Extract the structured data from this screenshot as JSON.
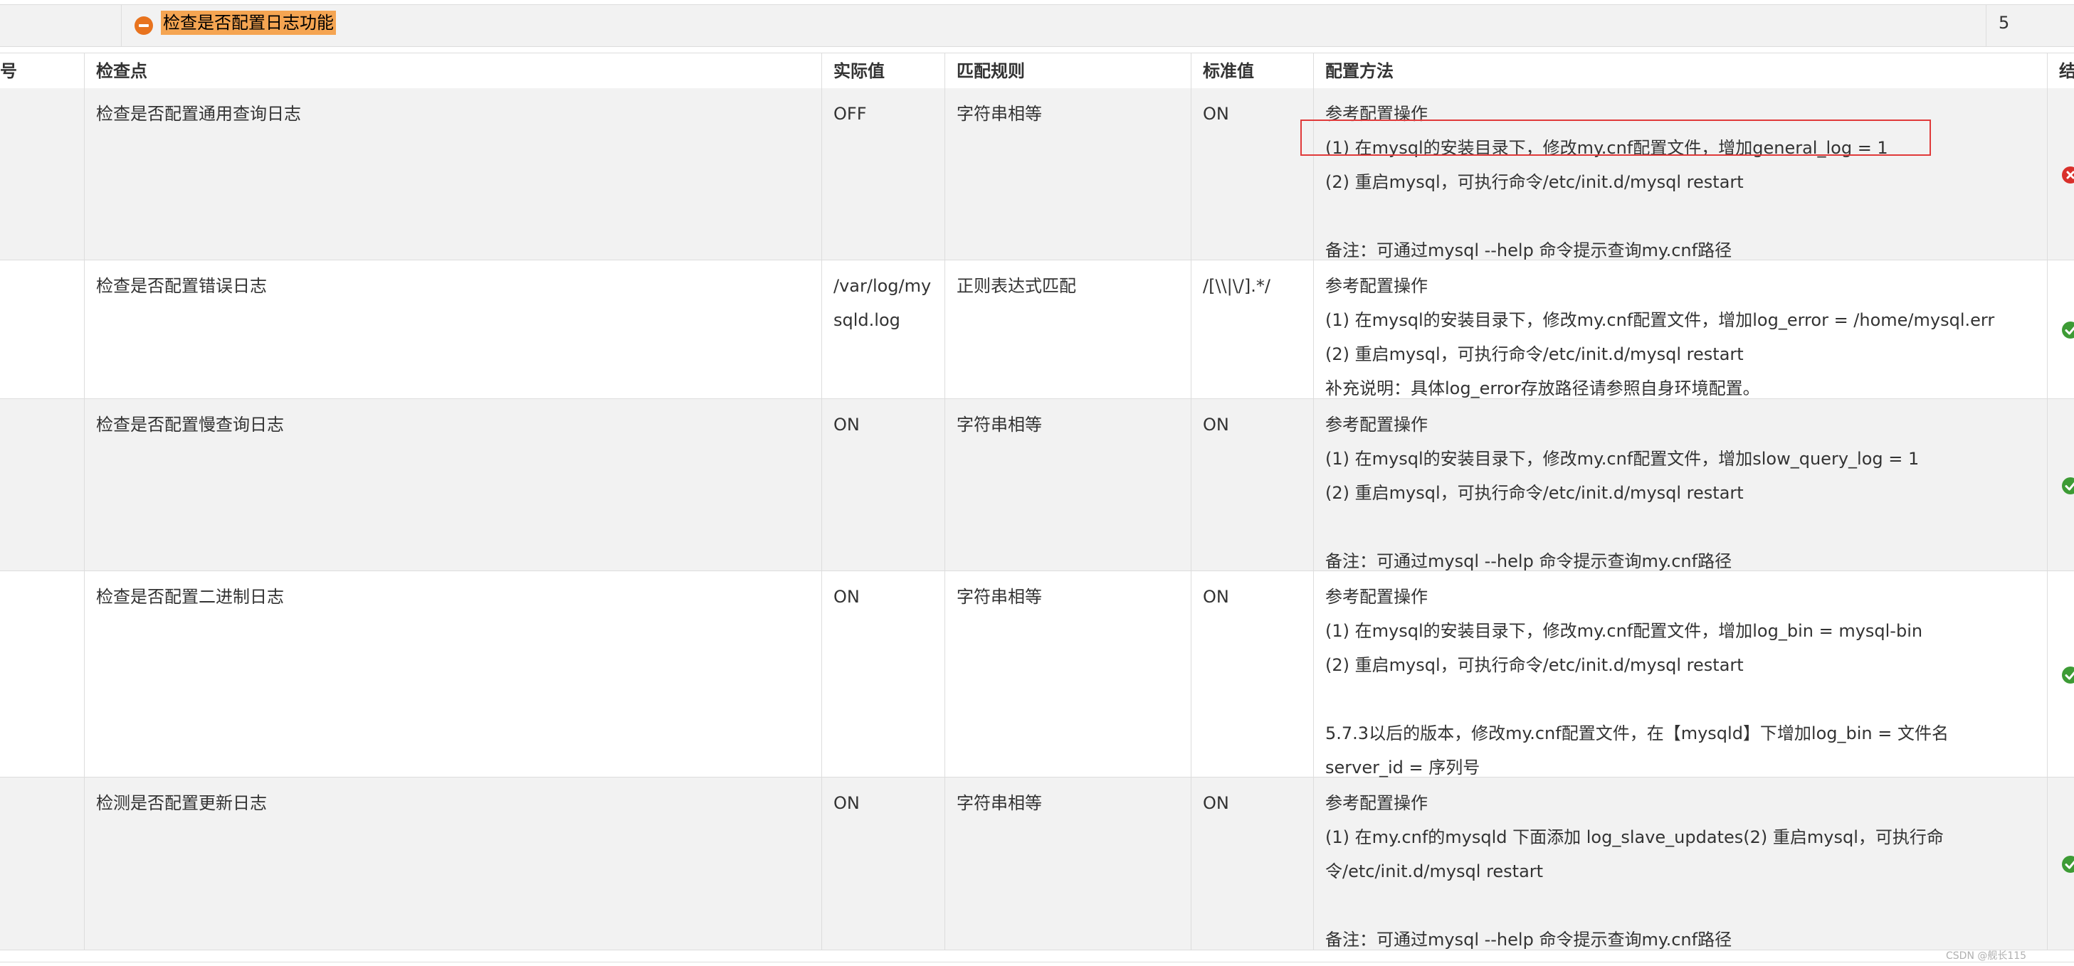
{
  "section": {
    "title": "检查是否配置日志功能",
    "count": "5",
    "icon": "minus-circle-icon",
    "highlight_color": "#f5a552"
  },
  "table": {
    "headers": {
      "index": "号",
      "check_point": "检查点",
      "actual": "实际值",
      "rule": "匹配规则",
      "standard": "标准值",
      "method": "配置方法",
      "result": "结"
    },
    "rows": [
      {
        "check_point": "检查是否配置通用查询日志",
        "actual": [
          "OFF"
        ],
        "rule": "字符串相等",
        "standard": "ON",
        "method": [
          "参考配置操作",
          "(1) 在mysql的安装目录下，修改my.cnf配置文件，增加general_log = 1",
          "(2) 重启mysql，可执行命令/etc/init.d/mysql restart",
          "",
          "备注：可通过mysql --help 命令提示查询my.cnf路径"
        ],
        "status": "fail",
        "status_icon": "fail-x-icon"
      },
      {
        "check_point": "检查是否配置错误日志",
        "actual": [
          "/var/log/my",
          "sqld.log"
        ],
        "rule": "正则表达式匹配",
        "standard": "/[\\\\|\\/].*/",
        "method": [
          "参考配置操作",
          "(1) 在mysql的安装目录下，修改my.cnf配置文件，增加log_error = /home/mysql.err",
          "(2) 重启mysql，可执行命令/etc/init.d/mysql restart",
          "补充说明：具体log_error存放路径请参照自身环境配置。"
        ],
        "status": "pass",
        "status_icon": "pass-check-icon"
      },
      {
        "check_point": "检查是否配置慢查询日志",
        "actual": [
          "ON"
        ],
        "rule": "字符串相等",
        "standard": "ON",
        "method": [
          "参考配置操作",
          "(1) 在mysql的安装目录下，修改my.cnf配置文件，增加slow_query_log = 1",
          "(2) 重启mysql，可执行命令/etc/init.d/mysql restart",
          "",
          "备注：可通过mysql --help 命令提示查询my.cnf路径"
        ],
        "status": "pass",
        "status_icon": "pass-check-icon"
      },
      {
        "check_point": "检查是否配置二进制日志",
        "actual": [
          "ON"
        ],
        "rule": "字符串相等",
        "standard": "ON",
        "method": [
          "参考配置操作",
          "(1) 在mysql的安装目录下，修改my.cnf配置文件，增加log_bin = mysql-bin",
          "(2) 重启mysql，可执行命令/etc/init.d/mysql restart",
          "",
          "5.7.3以后的版本，修改my.cnf配置文件，在【mysqld】下增加log_bin = 文件名",
          "server_id = 序列号"
        ],
        "status": "pass",
        "status_icon": "pass-check-icon"
      },
      {
        "check_point": "检测是否配置更新日志",
        "actual": [
          "ON"
        ],
        "rule": "字符串相等",
        "standard": "ON",
        "method": [
          "参考配置操作",
          "(1) 在my.cnf的mysqld 下面添加 log_slave_updates(2) 重启mysql，可执行命",
          "令/etc/init.d/mysql restart",
          "",
          "备注：可通过mysql --help 命令提示查询my.cnf路径"
        ],
        "status": "pass",
        "status_icon": "pass-check-icon"
      }
    ]
  },
  "colors": {
    "fail": "#d9302b",
    "pass": "#3d9b35",
    "annotation_box": "#e03a3a"
  },
  "watermark": "CSDN @舰长115"
}
